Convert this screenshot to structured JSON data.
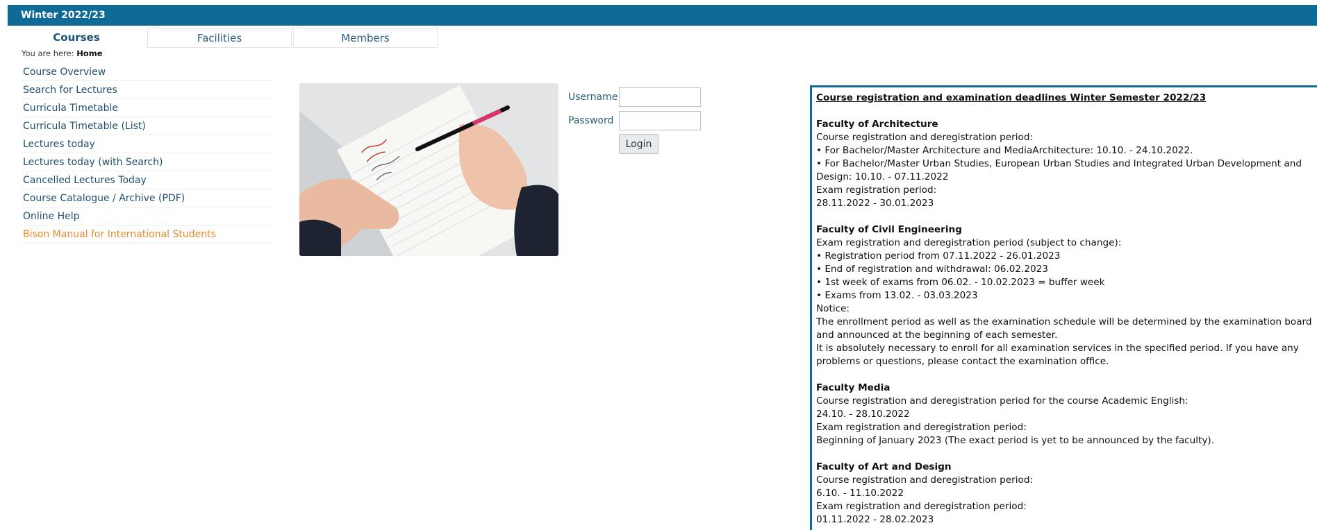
{
  "header": {
    "semester": "Winter 2022/23"
  },
  "tabs": [
    {
      "label": "Courses",
      "active": true
    },
    {
      "label": "Facilities",
      "active": false
    },
    {
      "label": "Members",
      "active": false
    }
  ],
  "breadcrumb": {
    "prefix": "You are here:",
    "current": "Home"
  },
  "sidebar": {
    "items": [
      {
        "label": "Course Overview"
      },
      {
        "label": "Search for Lectures"
      },
      {
        "label": "Curricula Timetable"
      },
      {
        "label": "Curricula Timetable (List)"
      },
      {
        "label": "Lectures today"
      },
      {
        "label": "Lectures today (with Search)"
      },
      {
        "label": "Cancelled Lectures Today"
      },
      {
        "label": "Course Catalogue / Archive (PDF)"
      },
      {
        "label": "Online Help"
      },
      {
        "label": "Bison Manual for International Students",
        "color": "#e8892e"
      }
    ]
  },
  "login": {
    "username_label": "Username",
    "password_label": "Password",
    "username_value": "",
    "password_value": "",
    "button_label": "Login"
  },
  "info": {
    "title": "Course registration and examination deadlines Winter Semester 2022/23",
    "sections": [
      {
        "heading": "Faculty of Architecture",
        "lines": [
          "Course registration and deregistration period:",
          "• For Bachelor/Master Architecture and MediaArchitecture: 10.10. - 24.10.2022.",
          "• For Bachelor/Master Urban Studies, European Urban Studies and Integrated Urban Development and Design: 10.10. - 07.11.2022",
          "Exam registration period:",
          "28.11.2022 - 30.01.2023"
        ]
      },
      {
        "heading": "Faculty of Civil Engineering",
        "lines": [
          "Exam registration and deregistration period (subject to change):",
          "• Registration period from 07.11.2022 - 26.01.2023",
          "• End of registration and withdrawal: 06.02.2023",
          "• 1st week of exams from 06.02. - 10.02.2023 = buffer week",
          "• Exams from 13.02. - 03.03.2023",
          "Notice:",
          "The enrollment period as well as the examination schedule will be determined by the examination board and announced at the beginning of each semester.",
          "It is absolutely necessary to enroll for all examination services in the specified period. If you have any problems or questions, please contact the examination office."
        ]
      },
      {
        "heading": "Faculty Media",
        "lines": [
          "Course registration and deregistration period for the course Academic English:",
          "24.10. - 28.10.2022",
          "Exam registration and deregistration period:",
          "Beginning of January 2023 (The exact period is yet to be announced by the faculty)."
        ]
      },
      {
        "heading": "Faculty of Art and Design",
        "lines": [
          "Course registration and deregistration period:",
          "6.10. - 11.10.2022",
          "Exam registration and deregistration period:",
          "01.11.2022 - 28.02.2023"
        ]
      }
    ]
  },
  "colors": {
    "brand": "#0f6a97",
    "link": "#1f4f6d",
    "highlight": "#e8892e"
  }
}
